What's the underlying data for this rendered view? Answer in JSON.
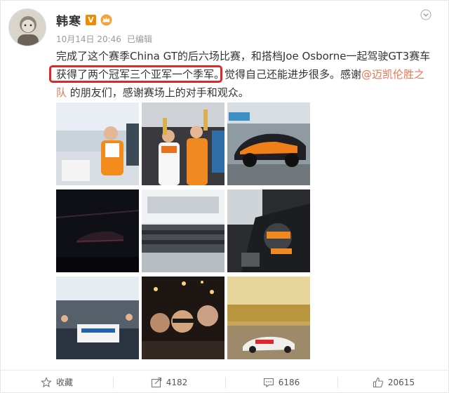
{
  "post": {
    "author": "韩寒",
    "verified_badge": "V",
    "date": "10月14日 20:46",
    "edited": "已编辑",
    "text_lines": [
      "完成了这个赛季China GT的后六场比赛，和搭档Joe Osborne一起驾驶GT3赛车",
      "获得了两个冠军三个亚军一个季军。",
      "觉得自己还能进步很多。感谢",
      "@迈凯伦胜之",
      "队",
      "的朋友们，感谢赛场上的对手和观众。"
    ]
  },
  "actions": {
    "favorite": "收藏",
    "repost": "4182",
    "comment": "6186",
    "like": "20615"
  },
  "colors": {
    "accent": "#eb7350",
    "highlight": "#e0262a",
    "vip": "#f08a00"
  },
  "icons": [
    "chevron-down-icon",
    "crown-icon",
    "star-icon",
    "share-icon",
    "comment-icon",
    "thumbs-up-icon"
  ]
}
